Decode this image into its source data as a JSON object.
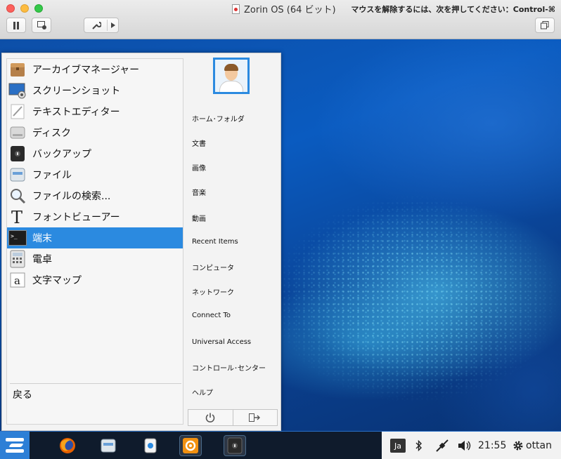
{
  "window": {
    "title": "Zorin OS (64 ビット)",
    "release_hint": "マウスを解除するには、次を押してください：Control-⌘"
  },
  "toolbar": {
    "pause_icon": "pause-icon",
    "snapshot_icon": "snapshot-icon",
    "settings_icon": "wrench-icon",
    "dropdown_icon": "triangle-right-icon",
    "restore_icon": "window-restore-icon"
  },
  "menu": {
    "apps": [
      {
        "label": "アーカイブマネージャー",
        "icon": "archive-manager-icon"
      },
      {
        "label": "スクリーンショット",
        "icon": "screenshot-icon"
      },
      {
        "label": "テキストエディター",
        "icon": "text-editor-icon"
      },
      {
        "label": "ディスク",
        "icon": "disks-icon"
      },
      {
        "label": "バックアップ",
        "icon": "backup-icon"
      },
      {
        "label": "ファイル",
        "icon": "files-icon"
      },
      {
        "label": "ファイルの検索...",
        "icon": "search-files-icon"
      },
      {
        "label": "フォントビューアー",
        "icon": "font-viewer-icon"
      },
      {
        "label": "端末",
        "icon": "terminal-icon",
        "selected": true
      },
      {
        "label": "電卓",
        "icon": "calculator-icon"
      },
      {
        "label": "文字マップ",
        "icon": "character-map-icon"
      }
    ],
    "back_label": "戻る",
    "places": [
      "ホーム･フォルダ",
      "文書",
      "画像",
      "音楽",
      "動画",
      "Recent Items",
      "コンピュータ",
      "ネットワーク",
      "Connect To",
      "Universal Access",
      "コントロール･センター",
      "ヘルプ"
    ],
    "power_icon": "power-icon",
    "logout_icon": "logout-icon"
  },
  "taskbar": {
    "ime": "Ja",
    "time": "21:55",
    "user": "ottan"
  },
  "colors": {
    "accent": "#2b8ae0",
    "taskbar": "#0f1b2c",
    "desktop": "#0a5bc0"
  }
}
